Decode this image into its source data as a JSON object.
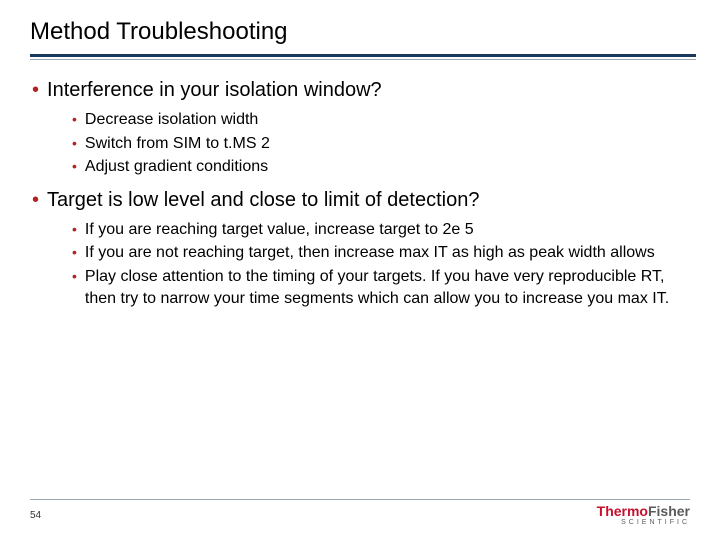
{
  "title": "Method Troubleshooting",
  "sections": [
    {
      "heading": "Interference in your isolation window?",
      "items": [
        "Decrease isolation width",
        "Switch from SIM to t.MS 2",
        "Adjust gradient conditions"
      ]
    },
    {
      "heading": "Target is low level and close to limit of detection?",
      "items": [
        "If you are reaching target value, increase target to 2e 5",
        "If you are not reaching target, then increase max IT as high as peak width allows",
        "Play close attention to the timing of your targets.  If you have very reproducible RT, then try to narrow your time segments which can allow you to increase you max IT."
      ]
    }
  ],
  "page_number": "54",
  "logo": {
    "thermo": "Thermo",
    "fisher": "Fisher",
    "sub": "SCIENTIFIC"
  }
}
